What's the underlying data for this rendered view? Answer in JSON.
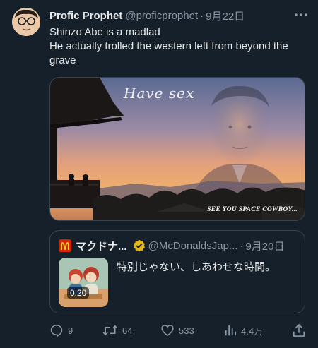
{
  "tweet": {
    "author_name": "Profic Prophet",
    "author_handle": "@proficprophet",
    "separator": "·",
    "date": "9月22日",
    "line1": "Shinzo Abe is a madlad",
    "line2": "He actually trolled the western left from beyond the grave",
    "avatar_icon": "cartoon-face-avatar",
    "more_icon": "more-horizontal-icon"
  },
  "media": {
    "caption_top": "Have sex",
    "caption_bottom": "SEE YOU SPACE COWBOY..."
  },
  "quote": {
    "author_name": "マクドナ...",
    "author_handle": "@McDonaldsJap...",
    "separator": "·",
    "date": "9月20日",
    "text": "特別じゃない、しあわせな時間。",
    "video_duration": "0:20",
    "brand_color": "#d62300",
    "verified_color": "#e2b719"
  },
  "actions": {
    "replies": "9",
    "retweets": "64",
    "likes": "533",
    "views": "4.4万"
  }
}
